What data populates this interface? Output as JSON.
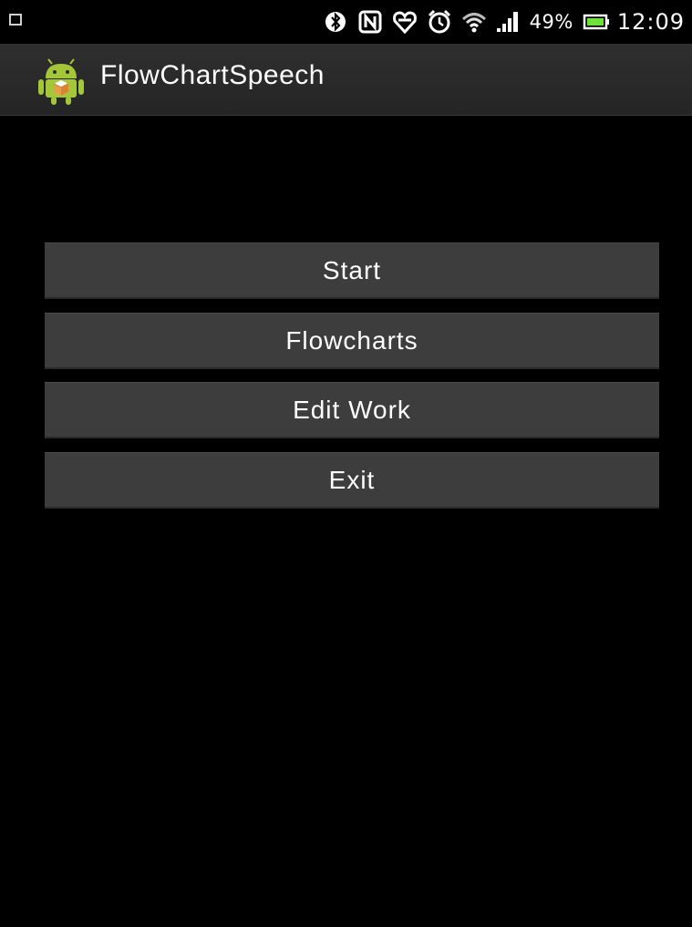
{
  "status_bar": {
    "icons": [
      "notification-icon",
      "bluetooth-icon",
      "nfc-icon",
      "heart-icon",
      "alarm-icon",
      "wifi-icon",
      "signal-icon",
      "battery-icon"
    ],
    "battery_percent": "49%",
    "time": "12:09"
  },
  "action_bar": {
    "icon": "android-app-icon",
    "title": "FlowChartSpeech"
  },
  "menu": {
    "start_label": "Start",
    "flowcharts_label": "Flowcharts",
    "edit_work_label": "Edit Work",
    "exit_label": "Exit"
  },
  "colors": {
    "background": "#000000",
    "action_bar": "#2a2a2a",
    "button": "#3d3d3d",
    "text": "#ffffff",
    "android_green": "#a4c639",
    "battery_green": "#6fe23a"
  }
}
